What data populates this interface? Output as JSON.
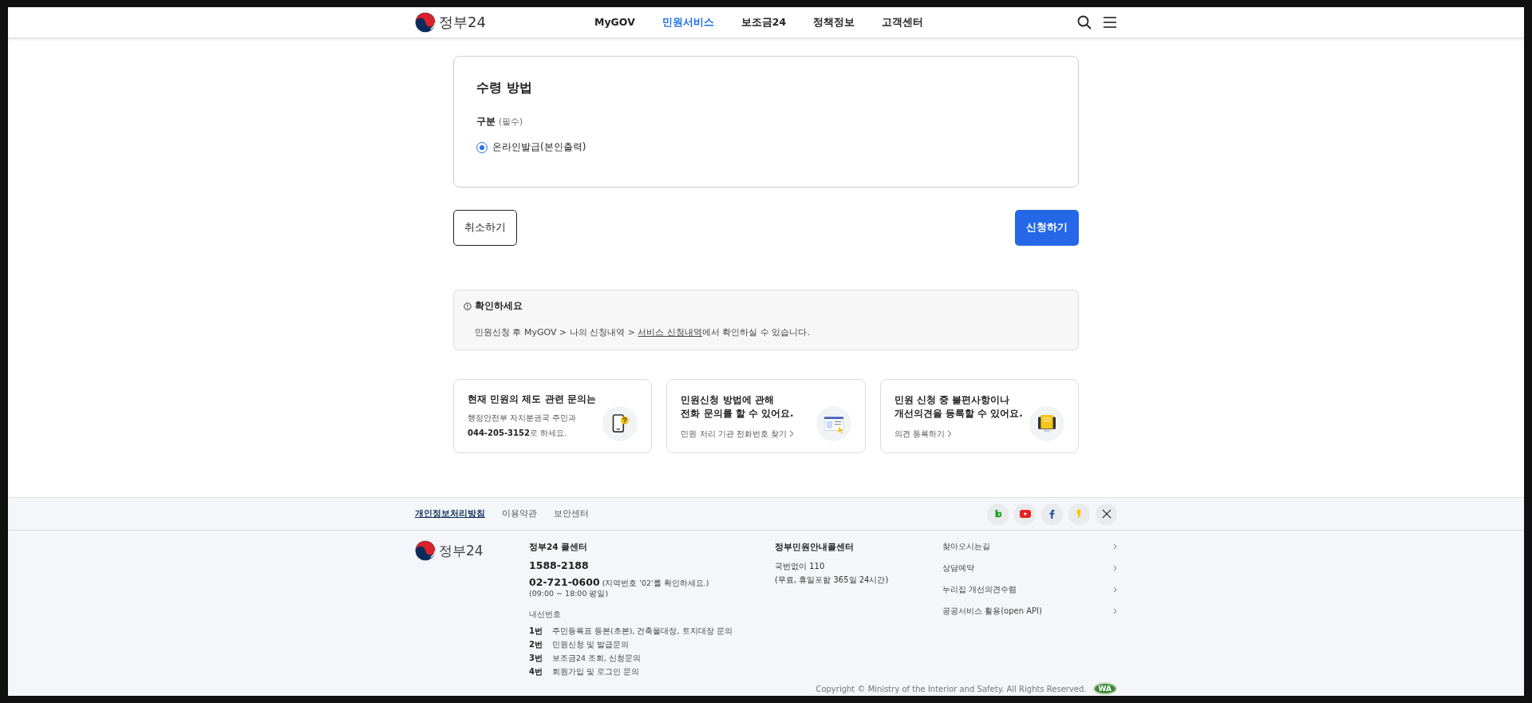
{
  "header": {
    "logo_text": "정부24",
    "nav": [
      {
        "label": "MyGOV",
        "selected": false
      },
      {
        "label": "민원서비스",
        "selected": true
      },
      {
        "label": "보조금24",
        "selected": false
      },
      {
        "label": "정책정보",
        "selected": false
      },
      {
        "label": "고객센터",
        "selected": false
      }
    ]
  },
  "receipt_card": {
    "title": "수령 방법",
    "field_label": "구분",
    "required_note": "(필수)",
    "options": [
      {
        "label": "온라인발급(본인출력)",
        "selected": true
      }
    ]
  },
  "buttons": {
    "cancel": "취소하기",
    "submit": "신청하기"
  },
  "notice": {
    "title": "확인하세요",
    "text_before": "민원신청 후 MyGOV > 나의 신청내역 > ",
    "link": "서비스 신청내역",
    "text_after": "에서 확인하실 수 있습니다."
  },
  "help_cards": [
    {
      "kind": "phone",
      "title": "현재 민원의 제도 관련 문의는",
      "lines": [
        "행정안전부 자치분권국 주민과",
        "**044-205-3152**로 하세요."
      ]
    },
    {
      "kind": "directory",
      "title": "민원신청 방법에 관해\n전화 문의를 할 수 있어요.",
      "link": "민원 처리 기관 전화번호 찾기"
    },
    {
      "kind": "feedback",
      "title": "민원 신청 중 불편사항이나\n개선의견을 등록할 수 있어요.",
      "link": "의견 등록하기"
    }
  ],
  "footer": {
    "links": [
      {
        "label": "개인정보처리방침",
        "selected": true
      },
      {
        "label": "이용약관",
        "selected": false
      },
      {
        "label": "보안센터",
        "selected": false
      }
    ],
    "social": [
      {
        "kind": "blog"
      },
      {
        "kind": "youtube"
      },
      {
        "kind": "facebook"
      },
      {
        "kind": "kakao"
      },
      {
        "kind": "x"
      }
    ],
    "logo_text": "정부24",
    "call_center": {
      "title": "정부24 콜센터",
      "main_phone": "1588-2188",
      "second_phone": "02-721-0600",
      "second_note": "(지역번호 '02'를 확인하세요.)",
      "hours": "(09:00 ~ 18:00 평일)",
      "ext_title": "내선번호",
      "extensions": [
        {
          "num": "1번",
          "desc": "주민등록표 등본(초본), 건축물대장, 토지대장 문의"
        },
        {
          "num": "2번",
          "desc": "민원신청 및 발급문의"
        },
        {
          "num": "3번",
          "desc": "보조금24 조회, 신청문의"
        },
        {
          "num": "4번",
          "desc": "회원가입 및 로그인 문의"
        }
      ]
    },
    "guide_center": {
      "title": "정부민원안내콜센터",
      "lines": [
        "국번없이 110",
        "(무료, 휴일포함 365일 24시간)"
      ]
    },
    "menu": [
      "찾아오시는길",
      "상담예약",
      "누리집 개선의견수렴",
      "공공서비스 활용(open API)"
    ],
    "copyright": "Copyright © Ministry of the Interior and Safety. All Rights Reserved.",
    "wa_mark": "WA"
  }
}
